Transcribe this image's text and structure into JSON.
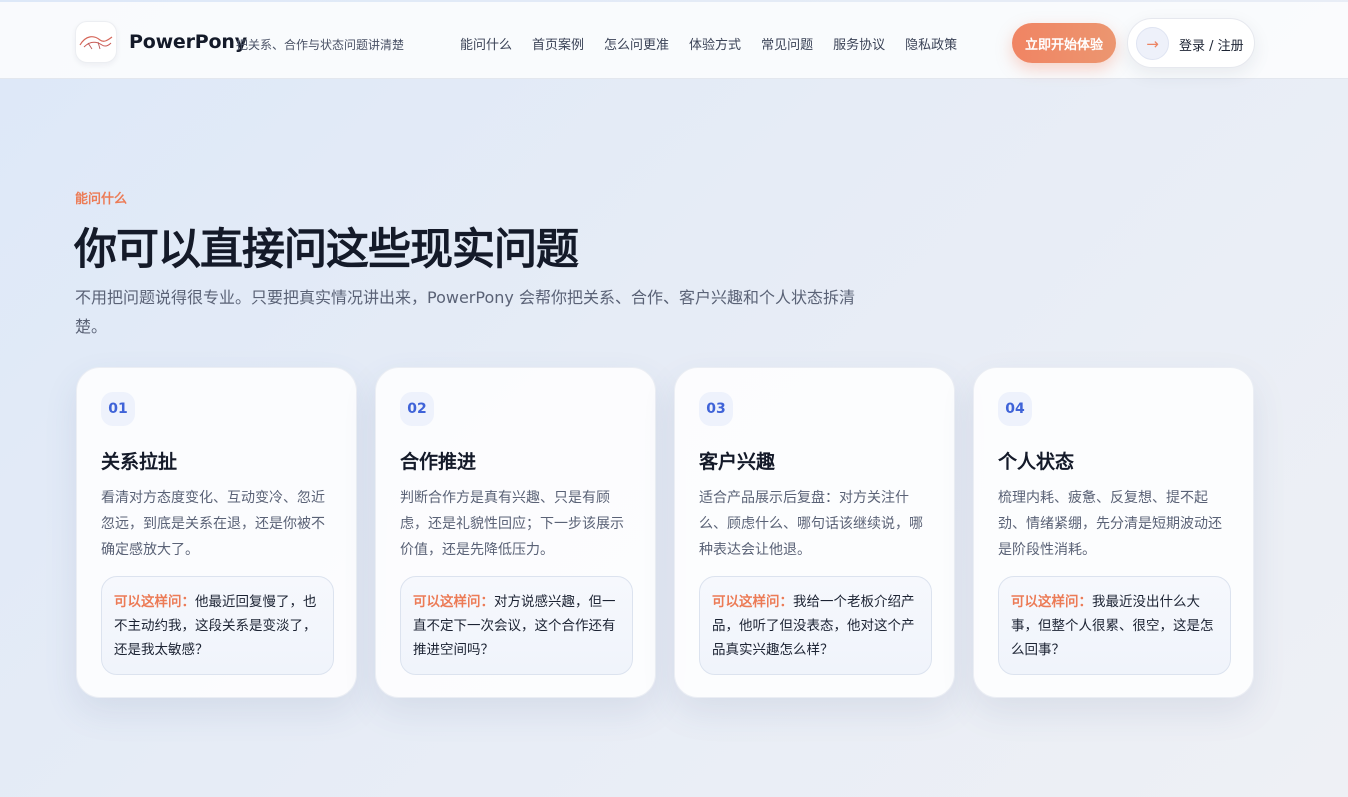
{
  "header": {
    "brand": "PowerPony",
    "tagline": "把关系、合作与状态问题讲清楚",
    "nav": [
      "能问什么",
      "首页案例",
      "怎么问更准",
      "体验方式",
      "常见问题",
      "服务协议",
      "隐私政策"
    ],
    "cta_label": "立即开始体验",
    "login_label": "登录 / 注册",
    "login_arrow": "→"
  },
  "hero": {
    "eyebrow": "能问什么",
    "title": "你可以直接问这些现实问题",
    "lead": "不用把问题说得很专业。只要把真实情况讲出来，PowerPony 会帮你把关系、合作、客户兴趣和个人状态拆清楚。"
  },
  "ask_prefix": "可以这样问：",
  "cards": [
    {
      "num": "01",
      "title": "关系拉扯",
      "desc": "看清对方态度变化、互动变冷、忽近忽远，到底是关系在退，还是你被不确定感放大了。",
      "example": "他最近回复慢了，也不主动约我，这段关系是变淡了，还是我太敏感？"
    },
    {
      "num": "02",
      "title": "合作推进",
      "desc": "判断合作方是真有兴趣、只是有顾虑，还是礼貌性回应；下一步该展示价值，还是先降低压力。",
      "example": "对方说感兴趣，但一直不定下一次会议，这个合作还有推进空间吗？"
    },
    {
      "num": "03",
      "title": "客户兴趣",
      "desc": "适合产品展示后复盘：对方关注什么、顾虑什么、哪句话该继续说，哪种表达会让他退。",
      "example": "我给一个老板介绍产品，他听了但没表态，他对这个产品真实兴趣怎么样？"
    },
    {
      "num": "04",
      "title": "个人状态",
      "desc": "梳理内耗、疲惫、反复想、提不起劲、情绪紧绷，先分清是短期波动还是阶段性消耗。",
      "example": "我最近没出什么大事，但整个人很累、很空，这是怎么回事？"
    }
  ],
  "colors": {
    "accent": "#ec7b56",
    "number_blue": "#3f63d8",
    "headline": "#141a29"
  }
}
